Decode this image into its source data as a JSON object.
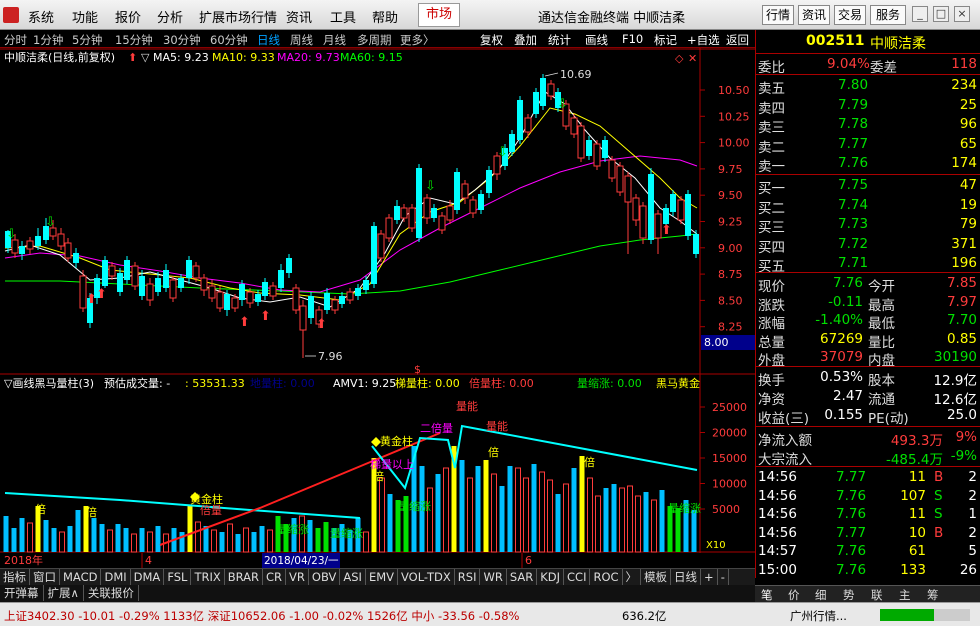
{
  "menubar": {
    "items": [
      "系统",
      "功能",
      "报价",
      "分析",
      "扩展市场行情",
      "资讯",
      "工具",
      "帮助"
    ],
    "market_tab": "市场",
    "app_title": "通达信金融终端  中顺洁柔",
    "right_buttons": [
      "行情",
      "资讯",
      "交易",
      "服务"
    ]
  },
  "periodbar": {
    "periods": [
      "分时",
      "1分钟",
      "5分钟",
      "15分钟",
      "30分钟",
      "60分钟",
      "日线",
      "周线",
      "月线",
      "多周期",
      "更多〉"
    ],
    "active": "日线",
    "tools": [
      "复权",
      "叠加",
      "统计",
      "画线",
      "F10",
      "标记",
      "+自选",
      "返回"
    ]
  },
  "kline": {
    "header_name": "中顺洁柔(日线,前复权)",
    "ma5": "MA5: 9.23",
    "ma10": "MA10: 9.33",
    "ma20": "MA20: 9.73",
    "ma60": "MA60: 9.15",
    "high_label": "10.69",
    "low_label": "7.96",
    "price_ticks": [
      "10.50",
      "10.25",
      "10.00",
      "9.75",
      "9.50",
      "9.25",
      "9.00",
      "8.75",
      "8.50",
      "8.25"
    ],
    "price_box": "8.00"
  },
  "volume": {
    "header_title": "▽画线黑马量柱(3)",
    "header_est": "预估成交量: -",
    "header_val": ": 53531.33",
    "header_dbl": "地量柱: 0.00",
    "header_amv": "AMV1: 9.25",
    "header_step": "梯量柱: 0.00",
    "header_beil": "倍量柱: 0.00",
    "header_shrink": "量缩涨: 0.00",
    "header_horse": "黑马黄金",
    "ticks": [
      "25000",
      "20000",
      "15000",
      "10000",
      "5000"
    ],
    "unit": "X10",
    "annotations": [
      "黄金柱",
      "黄金柱",
      "二倍量",
      "量能",
      "量能",
      "梯量以上",
      "倍",
      "倍",
      "倍",
      "倍",
      "倍",
      "量缩涨",
      "量缩涨",
      "量缩涨",
      "量缩涨",
      "倍量"
    ]
  },
  "dates": {
    "d1": "2018年",
    "d2": "4",
    "d3": "2018/04/23/一",
    "d4": "6"
  },
  "right": {
    "code": "002511",
    "name": "中顺洁柔",
    "weibi_label": "委比",
    "weibi": "9.04%",
    "weicha_label": "委差",
    "weicha": "118",
    "sells": [
      {
        "label": "卖五",
        "price": "7.80",
        "vol": "234"
      },
      {
        "label": "卖四",
        "price": "7.79",
        "vol": "25"
      },
      {
        "label": "卖三",
        "price": "7.78",
        "vol": "96"
      },
      {
        "label": "卖二",
        "price": "7.77",
        "vol": "65"
      },
      {
        "label": "卖一",
        "price": "7.76",
        "vol": "174"
      }
    ],
    "buys": [
      {
        "label": "买一",
        "price": "7.75",
        "vol": "47"
      },
      {
        "label": "买二",
        "price": "7.74",
        "vol": "19"
      },
      {
        "label": "买三",
        "price": "7.73",
        "vol": "79"
      },
      {
        "label": "买四",
        "price": "7.72",
        "vol": "371"
      },
      {
        "label": "买五",
        "price": "7.71",
        "vol": "196"
      }
    ],
    "stats": [
      {
        "l1": "现价",
        "v1": "7.76",
        "c1": "green",
        "l2": "今开",
        "v2": "7.85",
        "c2": "red"
      },
      {
        "l1": "涨跌",
        "v1": "-0.11",
        "c1": "green",
        "l2": "最高",
        "v2": "7.97",
        "c2": "red"
      },
      {
        "l1": "涨幅",
        "v1": "-1.40%",
        "c1": "green",
        "l2": "最低",
        "v2": "7.70",
        "c2": "green"
      },
      {
        "l1": "总量",
        "v1": "67269",
        "c1": "yellow",
        "l2": "量比",
        "v2": "0.85",
        "c2": "yellow"
      },
      {
        "l1": "外盘",
        "v1": "37079",
        "c1": "red",
        "l2": "内盘",
        "v2": "30190",
        "c2": "green"
      }
    ],
    "stats2": [
      {
        "l1": "换手",
        "v1": "0.53%",
        "l2": "股本",
        "v2": "12.9亿"
      },
      {
        "l1": "净资",
        "v1": "2.47",
        "l2": "流通",
        "v2": "12.6亿"
      },
      {
        "l1": "收益(三)",
        "v1": "0.155",
        "l2": "PE(动)",
        "v2": "25.0"
      }
    ],
    "flows": [
      {
        "label": "净流入额",
        "val": "493.3万",
        "pct": "9%",
        "color": "red"
      },
      {
        "label": "大宗流入",
        "val": "-485.4万",
        "pct": "-9%",
        "color": "green"
      }
    ],
    "ticks": [
      {
        "t": "14:56",
        "p": "7.77",
        "v": "11",
        "bs": "B",
        "n": "2"
      },
      {
        "t": "14:56",
        "p": "7.76",
        "v": "107",
        "bs": "S",
        "n": "2"
      },
      {
        "t": "14:56",
        "p": "7.76",
        "v": "11",
        "bs": "S",
        "n": "1"
      },
      {
        "t": "14:56",
        "p": "7.77",
        "v": "10",
        "bs": "B",
        "n": "2"
      },
      {
        "t": "14:57",
        "p": "7.76",
        "v": "61",
        "bs": "",
        "n": "5"
      },
      {
        "t": "15:00",
        "p": "7.76",
        "v": "133",
        "bs": "",
        "n": "26"
      }
    ],
    "bottom_tabs": [
      "笔",
      "价",
      "细",
      "势",
      "联",
      "主",
      "筹"
    ]
  },
  "tabs": [
    "指标",
    "窗口",
    "MACD",
    "DMI",
    "DMA",
    "FSL",
    "TRIX",
    "BRAR",
    "CR",
    "VR",
    "OBV",
    "ASI",
    "EMV",
    "VOL-TDX",
    "RSI",
    "WR",
    "SAR",
    "KDJ",
    "CCI",
    "ROC",
    "〉",
    "模板",
    "日线",
    "+",
    "-"
  ],
  "subtabs": [
    "开弹幕",
    "扩展∧",
    "关联报价"
  ],
  "status": {
    "text1": "上证3402.30  -10.01  -0.29%  1133亿  深证10652.06  -1.00  -0.02%  1526亿  中小 -33.56  -0.58%",
    "text2": "636.2亿",
    "text3": "广州行情..."
  },
  "colors": {
    "up": "#ff3c3c",
    "down": "#00ffff",
    "ma5": "#ffffff",
    "ma10": "#ffff00",
    "ma20": "#ff00ff",
    "ma60": "#00ff00"
  }
}
